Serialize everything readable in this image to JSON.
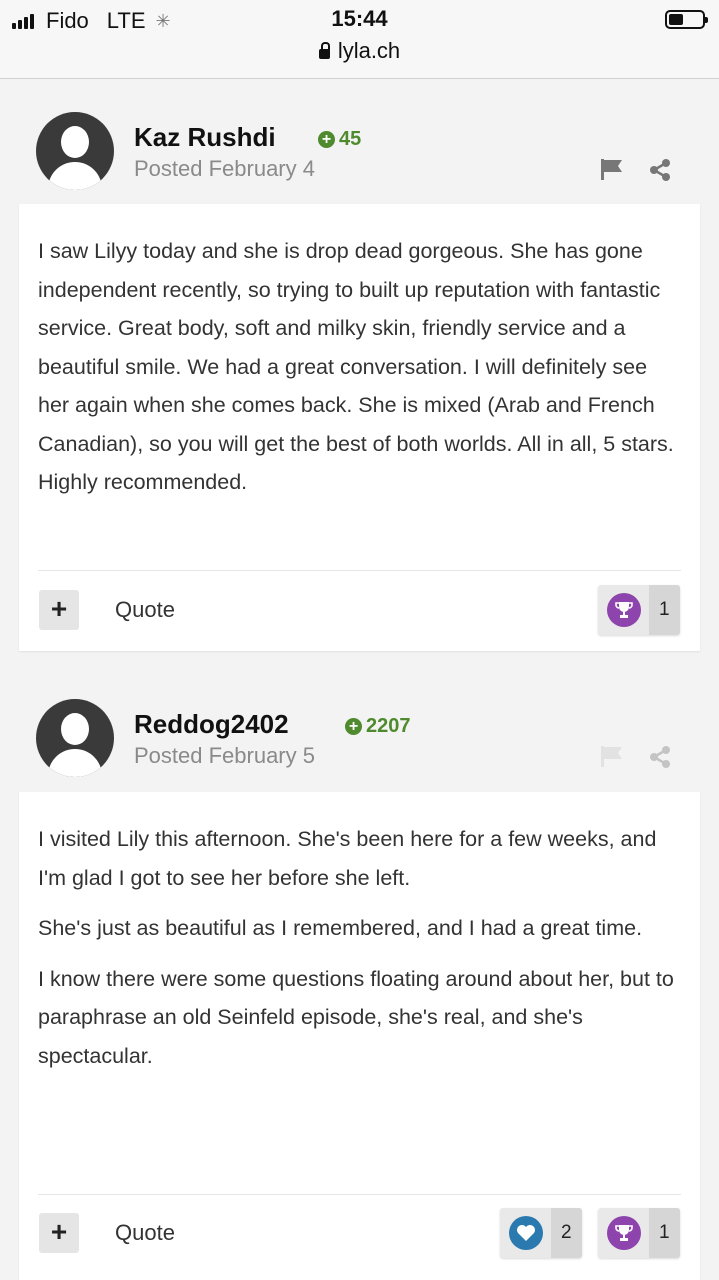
{
  "status_bar": {
    "carrier": "Fido",
    "network": "LTE",
    "time": "15:44",
    "url": "lyla.ch"
  },
  "posts": [
    {
      "author": "Kaz Rushdi",
      "reputation": "45",
      "posted": "Posted February 4",
      "body": [
        "I saw Lilyy today and she is drop dead gorgeous. She has gone independent recently, so trying to built up reputation with fantastic service. Great body, soft and milky skin, friendly service and a beautiful smile. We had a great conversation. I will definitely see her again when she comes back. She is mixed (Arab and French Canadian), so you will get the best of both worlds. All in all, 5 stars. Highly recommended."
      ],
      "quote_label": "Quote",
      "reactions": [
        {
          "icon": "trophy-icon",
          "color": "#8e44ad",
          "count": "1"
        }
      ]
    },
    {
      "author": "Reddog2402",
      "reputation": "2207",
      "posted": "Posted February 5",
      "body": [
        "I visited Lily this afternoon.  She's been here for a few weeks, and I'm glad I got to see her before she left.",
        "She's just as beautiful as I remembered, and I had a great time.",
        "I know there were some questions floating around about her, but to paraphrase an old Seinfeld episode, she's real, and she's spectacular."
      ],
      "quote_label": "Quote",
      "reactions": [
        {
          "icon": "heart-icon",
          "color": "#2a7ab0",
          "count": "2"
        },
        {
          "icon": "trophy-icon",
          "color": "#8e44ad",
          "count": "1"
        }
      ]
    }
  ],
  "colors": {
    "reputation_green": "#4f8a2e",
    "background": "#f3f3f3"
  }
}
